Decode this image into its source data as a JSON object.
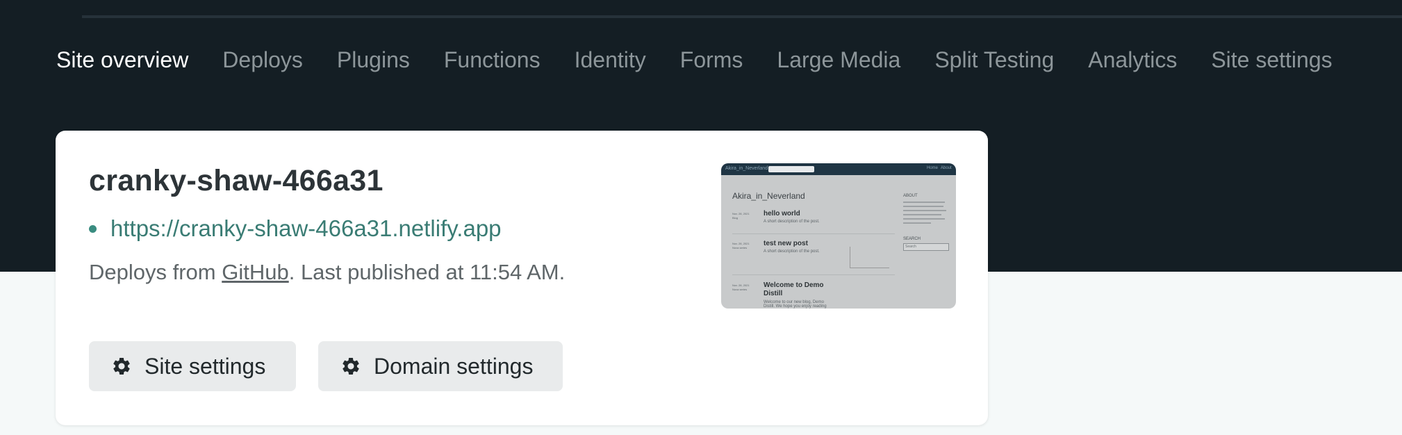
{
  "nav": {
    "items": [
      {
        "label": "Site overview",
        "active": true
      },
      {
        "label": "Deploys"
      },
      {
        "label": "Plugins"
      },
      {
        "label": "Functions"
      },
      {
        "label": "Identity"
      },
      {
        "label": "Forms"
      },
      {
        "label": "Large Media"
      },
      {
        "label": "Split Testing"
      },
      {
        "label": "Analytics"
      },
      {
        "label": "Site settings"
      }
    ]
  },
  "site": {
    "name": "cranky-shaw-466a31",
    "url": "https://cranky-shaw-466a31.netlify.app",
    "deploy_prefix": "Deploys from ",
    "deploy_source": "GitHub",
    "deploy_suffix": ". Last published at 11:54 AM."
  },
  "buttons": {
    "site_settings": "Site settings",
    "domain_settings": "Domain settings",
    "icon": "gear-icon"
  },
  "preview": {
    "brand": "Akira_in_Neverland",
    "nav": [
      "Home",
      "About"
    ],
    "heading": "Akira_in_Neverland",
    "posts": [
      {
        "date": "Nov. 28, 2021",
        "category": "Blog",
        "title": "hello world",
        "desc": "A short description of the post."
      },
      {
        "date": "Nov. 28, 2021",
        "category": "Nova series",
        "title": "test new post",
        "desc": "A short description of the post."
      },
      {
        "date": "Nov. 28, 2021",
        "category": "Nova series",
        "title": "Welcome to Demo Distill",
        "desc": "Welcome to our new blog, Demo Distill. We hope you enjoy reading"
      }
    ],
    "sidebar_about": "ABOUT",
    "sidebar_search": "SEARCH",
    "search_placeholder": "Search"
  },
  "colors": {
    "header_bg": "#141e24",
    "page_bg": "#f5f9f9",
    "link": "#3a7c74",
    "status_dot": "#3a8c80"
  }
}
